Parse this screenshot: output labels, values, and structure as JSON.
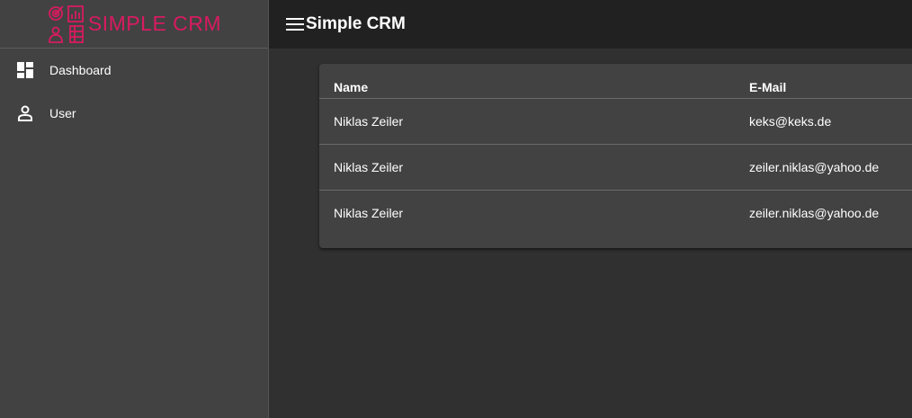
{
  "brand": {
    "logo_text": "SIMPLE CRM",
    "color": "#d81b60"
  },
  "header": {
    "title": "Simple CRM",
    "menu_icon": "menu-icon"
  },
  "sidebar": {
    "items": [
      {
        "label": "Dashboard",
        "icon": "dashboard-icon"
      },
      {
        "label": "User",
        "icon": "person-icon"
      }
    ]
  },
  "table": {
    "columns": [
      "Name",
      "E-Mail"
    ],
    "rows": [
      {
        "name": "Niklas Zeiler",
        "email": "keks@keks.de"
      },
      {
        "name": "Niklas Zeiler",
        "email": "zeiler.niklas@yahoo.de"
      },
      {
        "name": "Niklas Zeiler",
        "email": "zeiler.niklas@yahoo.de"
      }
    ]
  }
}
